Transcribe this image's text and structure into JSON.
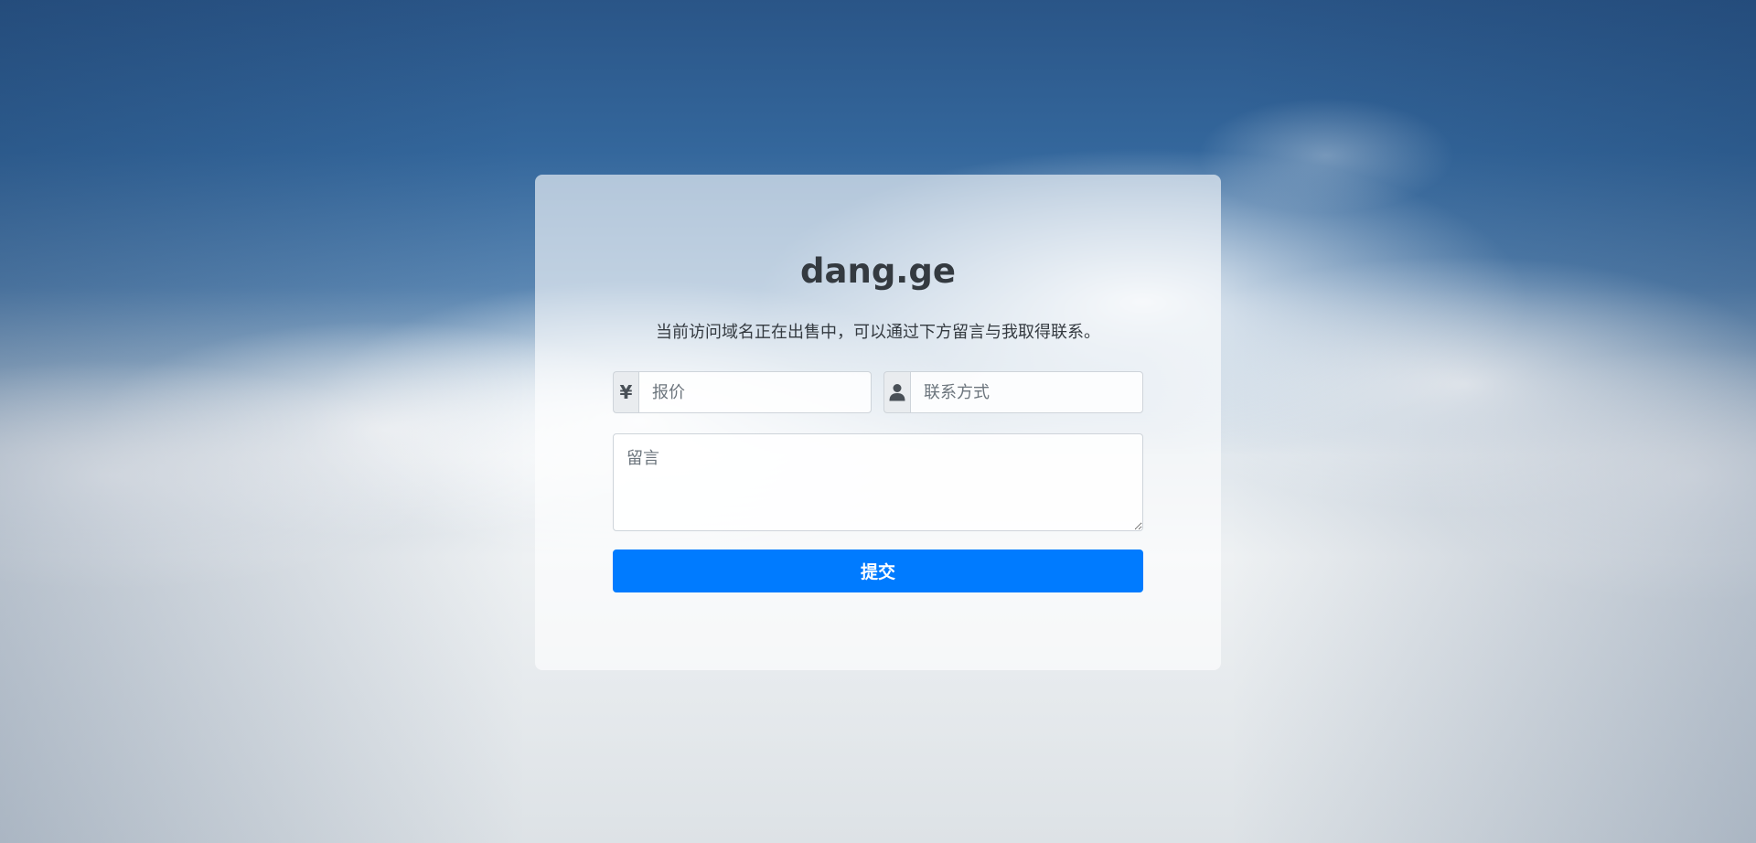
{
  "page": {
    "title": "dang.ge",
    "subtitle": "当前访问域名正在出售中，可以通过下方留言与我取得联系。"
  },
  "form": {
    "price": {
      "addon_symbol": "¥",
      "placeholder": "报价",
      "value": ""
    },
    "contact": {
      "addon_icon": "user-icon",
      "placeholder": "联系方式",
      "value": ""
    },
    "message": {
      "placeholder": "留言",
      "value": ""
    },
    "submit_label": "提交"
  },
  "colors": {
    "accent": "#007bff",
    "text": "#343a40",
    "addon_bg": "#e9ecef",
    "border": "#ced4da"
  }
}
